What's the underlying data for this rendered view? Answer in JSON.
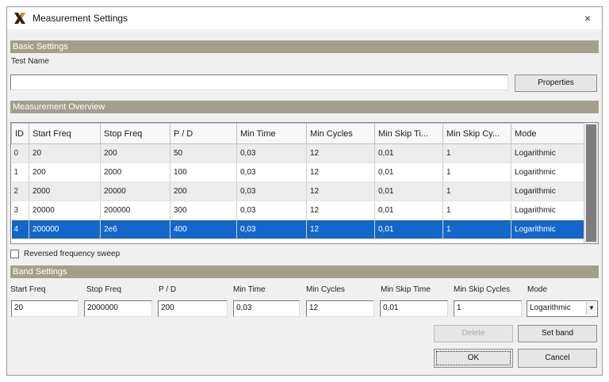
{
  "window": {
    "title": "Measurement Settings",
    "close": "×"
  },
  "basic": {
    "header": "Basic Settings",
    "test_name_label": "Test Name",
    "test_name_value": "",
    "properties_button": "Properties"
  },
  "overview": {
    "header": "Measurement Overview",
    "columns": [
      "ID",
      "Start Freq",
      "Stop Freq",
      "P / D",
      "Min Time",
      "Min Cycles",
      "Min Skip Ti...",
      "Min Skip Cy...",
      "Mode"
    ],
    "rows": [
      [
        "0",
        "20",
        "200",
        "50",
        "0,03",
        "12",
        "0,01",
        "1",
        "Logarithmic"
      ],
      [
        "1",
        "200",
        "2000",
        "100",
        "0,03",
        "12",
        "0,01",
        "1",
        "Logarithmic"
      ],
      [
        "2",
        "2000",
        "20000",
        "200",
        "0,03",
        "12",
        "0,01",
        "1",
        "Logarithmic"
      ],
      [
        "3",
        "20000",
        "200000",
        "300",
        "0,03",
        "12",
        "0,01",
        "1",
        "Logarithmic"
      ],
      [
        "4",
        "200000",
        "2e6",
        "400",
        "0,03",
        "12",
        "0,01",
        "1",
        "Logarithmic"
      ]
    ],
    "selected_row": 4,
    "reversed_label": "Reversed frequency sweep",
    "reversed_checked": false
  },
  "band": {
    "header": "Band Settings",
    "labels": {
      "start": "Start Freq",
      "stop": "Stop Freq",
      "pd": "P / D",
      "min_time": "Min Time",
      "min_cycles": "Min Cycles",
      "min_skip_time": "Min Skip Time",
      "min_skip_cycles": "Min Skip Cycles",
      "mode": "Mode"
    },
    "values": {
      "start": "20",
      "stop": "2000000",
      "pd": "200",
      "min_time": "0,03",
      "min_cycles": "12",
      "min_skip_time": "0,01",
      "min_skip_cycles": "1",
      "mode": "Logarithmic"
    },
    "delete_button": "Delete",
    "set_band_button": "Set band",
    "ok_button": "OK",
    "cancel_button": "Cancel"
  },
  "colors": {
    "section_header": "#a39f8b",
    "selection": "#1467c8"
  }
}
